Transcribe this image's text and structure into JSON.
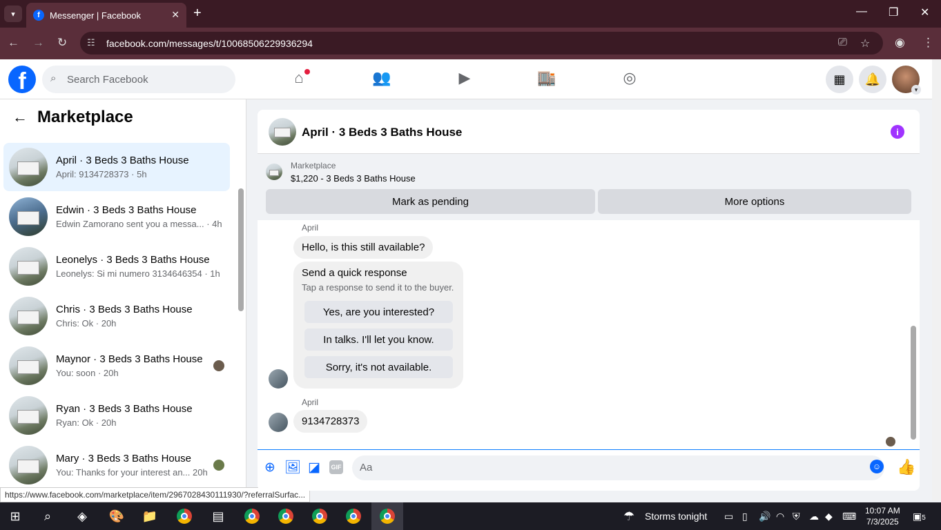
{
  "browser": {
    "tab_title": "Messenger | Facebook",
    "url": "facebook.com/messages/t/10068506229936294",
    "status_url": "https://www.facebook.com/marketplace/item/2967028430111930/?referralSurfac..."
  },
  "header": {
    "search_placeholder": "Search Facebook"
  },
  "sidebar": {
    "title": "Marketplace",
    "conversations": [
      {
        "name": "April · 3 Beds 3 Baths House",
        "preview": "April: 9134728373 · 5h"
      },
      {
        "name": "Edwin · 3 Beds 3 Baths House",
        "preview": "Edwin Zamorano sent you a messa...  · 4h"
      },
      {
        "name": "Leonelys · 3 Beds 3 Baths House",
        "preview": "Leonelys: Si mi numero 3134646354 · 1h"
      },
      {
        "name": "Chris · 3 Beds 3 Baths House",
        "preview": "Chris: Ok · 20h"
      },
      {
        "name": "Maynor · 3 Beds 3 Baths House",
        "preview": "You: soon · 20h"
      },
      {
        "name": "Ryan · 3 Beds 3 Baths House",
        "preview": "Ryan: Ok · 20h"
      },
      {
        "name": "Mary · 3 Beds 3 Baths House",
        "preview": "You: Thanks for your interest an...  20h"
      }
    ]
  },
  "chat": {
    "title": "April · 3 Beds 3 Baths House",
    "listing_label": "Marketplace",
    "listing_detail": "$1,220 - 3 Beds 3 Baths House",
    "mark_pending": "Mark as pending",
    "more_options": "More options",
    "sender1": "April",
    "message1": "Hello, is this still available?",
    "quick_title": "Send a quick response",
    "quick_sub": "Tap a response to send it to the buyer.",
    "quick_1": "Yes, are you interested?",
    "quick_2": "In talks. I'll let you know.",
    "quick_3": "Sorry, it's not available.",
    "sender2": "April",
    "message2": "9134728373",
    "composer_placeholder": "Aa",
    "gif_label": "GIF"
  },
  "taskbar": {
    "weather": "Storms tonight",
    "time": "10:07 AM",
    "date": "7/3/2025",
    "notifications": "5"
  }
}
